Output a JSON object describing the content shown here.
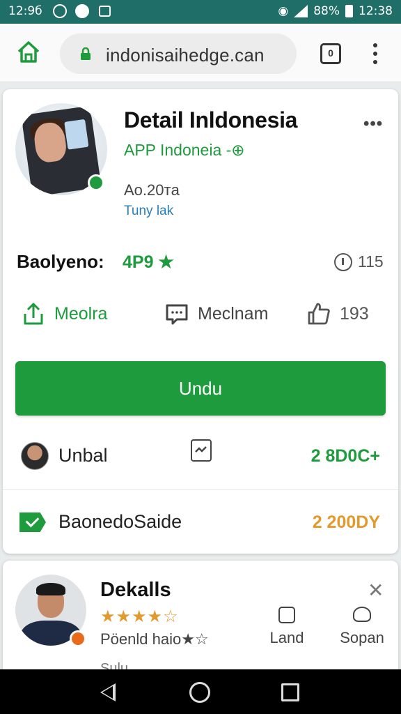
{
  "status_bar": {
    "time_left": "12:9б",
    "battery_pct": "88%",
    "time_right": "12:38"
  },
  "browser": {
    "url": "indonisaihedge.can",
    "tabs_count": "0"
  },
  "app": {
    "title": "Detail Inldonesia",
    "subtitle": "APP Indoneia -⊕",
    "meta": "Ao.20тa",
    "link": "Tuny lak",
    "rating_label": "Baolyeno:",
    "rating_value": "4P9 ★",
    "rating_right": "115",
    "actions": [
      {
        "label": "Meolra",
        "icon": "share-icon"
      },
      {
        "label": "Meclnam",
        "icon": "comment-icon"
      },
      {
        "label": "193",
        "icon": "thumbs-up-icon"
      }
    ],
    "download_label": "Undu",
    "rows": [
      {
        "label": "Unbal",
        "value": "2 8D0C+",
        "color": "#1e9b3c"
      },
      {
        "label": "BaonedoSaide",
        "value": "2 200DY",
        "color": "#e39a2d"
      }
    ]
  },
  "review": {
    "name": "Dekalls",
    "stars": "★★★★☆",
    "text": "Pöenld haio★☆",
    "action_1": "Land",
    "action_2": "Sopan",
    "cut_text": "Sulu... ..."
  },
  "colors": {
    "accent": "#1e9b3c",
    "status_bar": "#1f6e68",
    "orange": "#e39a2d",
    "link": "#2a7fbd"
  }
}
